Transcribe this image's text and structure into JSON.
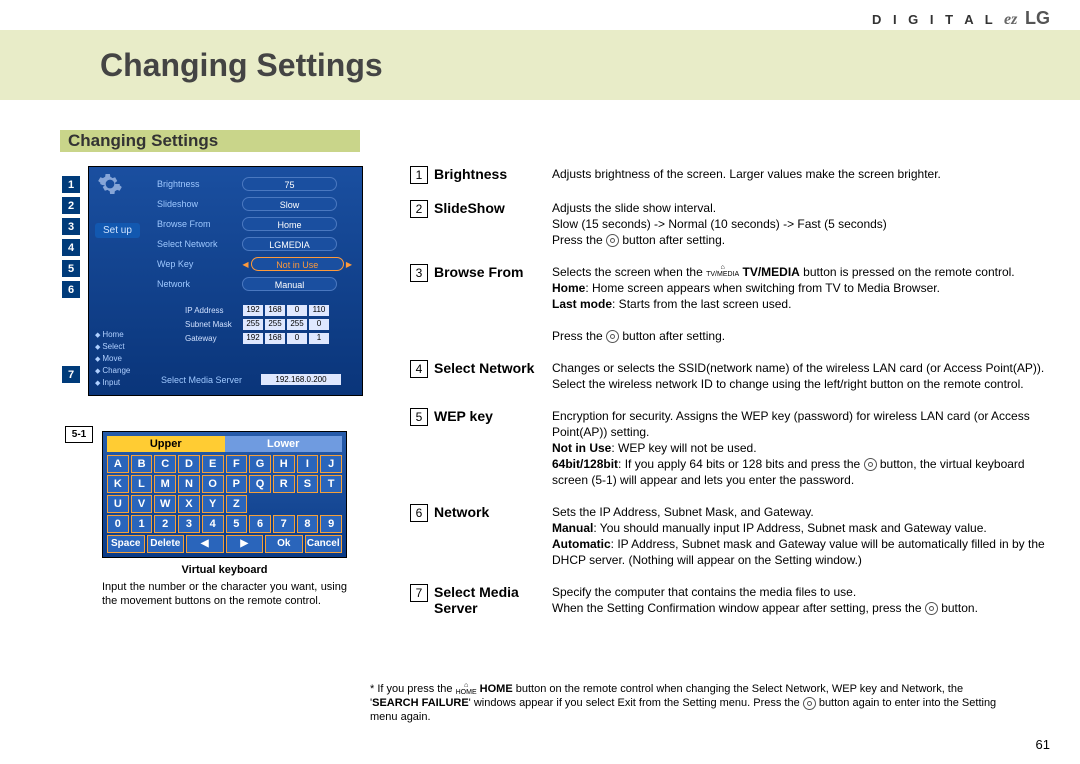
{
  "brand": {
    "digital": "D I G I T A L",
    "ez": "ez",
    "lg": "LG"
  },
  "banner_title": "Changing Settings",
  "section_title": "Changing Settings",
  "setup": {
    "title": "Set up",
    "rows": {
      "brightness": {
        "label": "Brightness",
        "value": "75"
      },
      "slideshow": {
        "label": "Slideshow",
        "value": "Slow"
      },
      "browsefrom": {
        "label": "Browse From",
        "value": "Home"
      },
      "selectnet": {
        "label": "Select Network",
        "value": "LGMEDIA"
      },
      "wepkey": {
        "label": "Wep Key",
        "value": "Not in Use"
      },
      "network": {
        "label": "Network",
        "value": "Manual"
      }
    },
    "footer": {
      "home": "Home",
      "select": "Select",
      "move": "Move",
      "change": "Change",
      "input": "Input"
    },
    "net": {
      "ip_label": "IP Address",
      "ip": [
        "192",
        "168",
        "0",
        "110"
      ],
      "sm_label": "Subnet Mask",
      "sm": [
        "255",
        "255",
        "255",
        "0"
      ],
      "gw_label": "Gateway",
      "gw": [
        "192",
        "168",
        "0",
        "1"
      ]
    },
    "server": {
      "label": "Select Media Server",
      "value": "192.168.0.200"
    }
  },
  "side_numbers": [
    "1",
    "2",
    "3",
    "4",
    "5",
    "6",
    "7"
  ],
  "kb_marker": "5-1",
  "vkb": {
    "upper": "Upper",
    "lower": "Lower",
    "row1": [
      "A",
      "B",
      "C",
      "D",
      "E",
      "F",
      "G",
      "H",
      "I",
      "J"
    ],
    "row2": [
      "K",
      "L",
      "M",
      "N",
      "O",
      "P",
      "Q",
      "R",
      "S",
      "T"
    ],
    "row3": [
      "U",
      "V",
      "W",
      "X",
      "Y",
      "Z",
      "",
      "",
      "",
      ""
    ],
    "row4": [
      "0",
      "1",
      "2",
      "3",
      "4",
      "5",
      "6",
      "7",
      "8",
      "9"
    ],
    "bottom": [
      "Space",
      "Delete",
      "◀",
      "▶",
      "Ok",
      "Cancel"
    ],
    "caption": "Virtual keyboard",
    "desc": "Input the number or the character you want, using the movement buttons on the remote control."
  },
  "items": [
    {
      "num": "1",
      "title": "Brightness",
      "desc": "Adjusts brightness of the screen. Larger values make the screen brighter."
    },
    {
      "num": "2",
      "title": "SlideShow",
      "desc": "Adjusts the slide show interval.<br>Slow (15 seconds) -> Normal (10 seconds) -> Fast (5 seconds)<br>Press the <span class='okbtn' data-name='ok-icon' data-interactable='false'></span> button after setting."
    },
    {
      "num": "3",
      "title": "Browse From",
      "desc": "Selects the screen when the <span class='home-icon'>⌂<br>TV/MEDIA</span> <b>TV/MEDIA</b> button is pressed on the remote control.<br><b>Home</b>: Home screen appears when switching from TV to Media Browser.<br><b>Last mode</b>: Starts from the last screen used.<br><br>Press the <span class='okbtn' data-name='ok-icon' data-interactable='false'></span> button after setting."
    },
    {
      "num": "4",
      "title": "Select Network",
      "desc": "Changes or selects the SSID(network name) of the wireless LAN card (or Access Point(AP)).<br>Select the wireless network ID to change using the left/right button on the remote control."
    },
    {
      "num": "5",
      "title": "WEP key",
      "desc": "Encryption for security. Assigns the WEP key (password) for wireless LAN card (or Access Point(AP)) setting.<br><b>Not in Use</b>: WEP key will not be used.<br><b>64bit/128bit</b>: If you apply 64 bits or 128 bits and press the <span class='okbtn' data-name='ok-icon' data-interactable='false'></span> button, the virtual keyboard screen (5-1) will appear and lets you enter the password."
    },
    {
      "num": "6",
      "title": "Network",
      "desc": "Sets the IP Address, Subnet Mask, and Gateway.<br><b>Manual</b>: You should manually input IP Address, Subnet mask and Gateway value.<br><b>Automatic</b>: IP Address, Subnet mask and Gateway value will be automatically filled in by the DHCP server. (Nothing will appear on the Setting window.)"
    },
    {
      "num": "7",
      "title": "Select Media Server",
      "desc": "Specify the computer that contains the media files to use.<br>When the Setting Confirmation window appear after setting, press the <span class='okbtn' data-name='ok-icon' data-interactable='false'></span> button."
    }
  ],
  "footnote": "* If you press the <span class='home-icon'>⌂<br>HOME</span> <b>HOME</b> button on the remote control when changing the Select Network, WEP key and Network, the '<b>SEARCH FAILURE</b>' windows appear if you select Exit from the Setting menu. Press the <span class='okbtn' data-name='ok-icon' data-interactable='false'></span> button again to enter into the Setting menu again.",
  "page_number": "61"
}
